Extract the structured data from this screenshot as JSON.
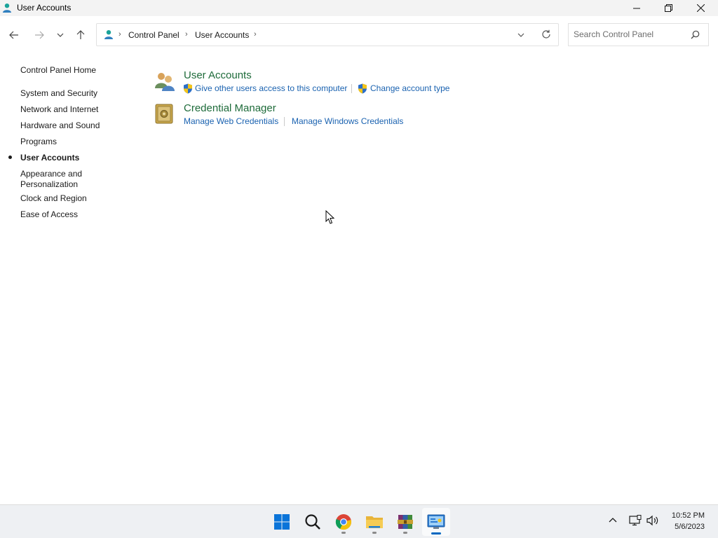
{
  "window": {
    "title": "User Accounts"
  },
  "address": {
    "crumbs": [
      "Control Panel",
      "User Accounts"
    ]
  },
  "search": {
    "placeholder": "Search Control Panel"
  },
  "left_nav": {
    "home": "Control Panel Home",
    "items": [
      "System and Security",
      "Network and Internet",
      "Hardware and Sound",
      "Programs",
      "User Accounts",
      "Appearance and Personalization",
      "Clock and Region",
      "Ease of Access"
    ],
    "selected": "User Accounts"
  },
  "categories": [
    {
      "title": "User Accounts",
      "icon": "users-icon",
      "links": [
        "Give other users access to this computer",
        "Change account type"
      ]
    },
    {
      "title": "Credential Manager",
      "icon": "vault-icon",
      "links": [
        "Manage Web Credentials",
        "Manage Windows Credentials"
      ]
    }
  ],
  "taskbar": {
    "apps": [
      "start-icon",
      "search-icon",
      "chrome-icon",
      "file-explorer-icon",
      "winrar-icon",
      "control-panel-icon"
    ],
    "clock_time": "10:52 PM",
    "clock_date": "5/6/2023"
  },
  "colors": {
    "category_title": "#1e6b3a",
    "link": "#1a62b0",
    "accent": "#0067c0"
  }
}
